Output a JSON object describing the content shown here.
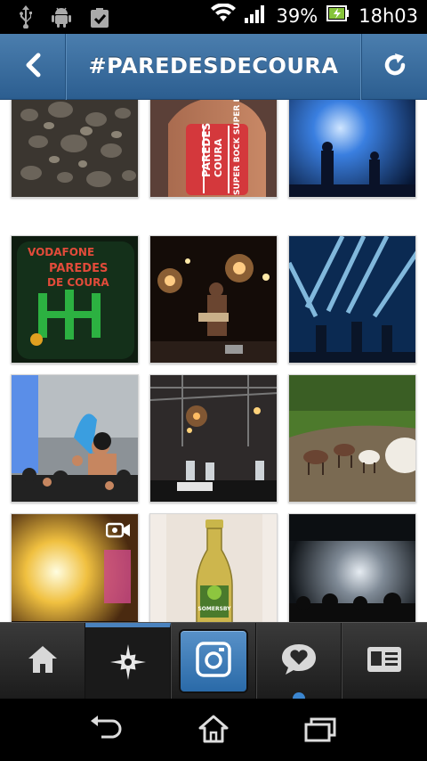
{
  "status_bar": {
    "battery_percent": "39%",
    "time": "18h03",
    "icons": [
      "usb-icon",
      "android-debug-icon",
      "clipboard-check-icon",
      "wifi-icon",
      "signal-icon",
      "battery-charging-icon"
    ]
  },
  "header": {
    "title": "#PAREDESDECOURA",
    "back_icon": "chevron-left-icon",
    "refresh_icon": "refresh-icon",
    "colors": {
      "bar": "#3a6c9e",
      "accent": "#4a82bd"
    }
  },
  "grid": {
    "photos": [
      {
        "subject": "pebbles",
        "video": false
      },
      {
        "subject": "festival-wristband",
        "video": false
      },
      {
        "subject": "blue-lit-stage",
        "video": false
      },
      {
        "subject": "green-projection-sign",
        "video": false
      },
      {
        "subject": "guitarist-spotlights",
        "video": false
      },
      {
        "subject": "blue-laser-stage",
        "video": false
      },
      {
        "subject": "crowd-surfing",
        "video": false
      },
      {
        "subject": "stage-rigging",
        "video": false
      },
      {
        "subject": "goats-field",
        "video": false
      },
      {
        "subject": "bright-stage-lights",
        "video": true
      },
      {
        "subject": "somersby-bottle",
        "video": false
      },
      {
        "subject": "night-concert-crowd",
        "video": false
      }
    ],
    "bottle_label": "SOMERSBY"
  },
  "projection_sign": [
    "VODAFONE",
    "PAREDES",
    "DE COURA"
  ],
  "wristband_text": [
    "PAREDES",
    "COURA",
    "SUPER BOCK SUPER ROCK"
  ],
  "tab_bar": {
    "tabs": [
      {
        "icon": "home-icon",
        "active": false
      },
      {
        "icon": "explore-star-icon",
        "active": true
      },
      {
        "icon": "camera-icon",
        "active": false
      },
      {
        "icon": "heart-bubble-icon",
        "active": false,
        "has_notification": true
      },
      {
        "icon": "profile-card-icon",
        "active": false
      }
    ]
  },
  "nav_bar": {
    "icons": [
      "back-arrow-icon",
      "home-outline-icon",
      "recent-apps-icon"
    ]
  }
}
